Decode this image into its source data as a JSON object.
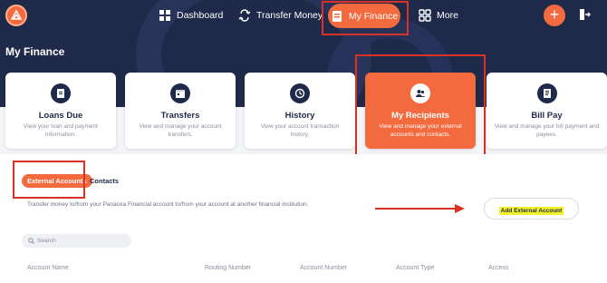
{
  "nav": {
    "dashboard": "Dashboard",
    "transfer": "Transfer Money",
    "finance": "My Finance",
    "more": "More",
    "add_symbol": "+"
  },
  "page": {
    "title": "My Finance"
  },
  "cards": [
    {
      "title": "Loans Due",
      "desc": "View your loan and payment information.",
      "icon": "document-icon"
    },
    {
      "title": "Transfers",
      "desc": "View and manage your account transfers.",
      "icon": "calendar-icon"
    },
    {
      "title": "History",
      "desc": "View your account transaction history.",
      "icon": "history-icon"
    },
    {
      "title": "My Recipients",
      "desc": "View and manage your external accounts and contacts.",
      "icon": "users-icon"
    },
    {
      "title": "Bill Pay",
      "desc": "View and manage your bill payment and payees.",
      "icon": "bill-icon"
    }
  ],
  "tabs": {
    "external": "External Accounts",
    "contacts": "Contacts"
  },
  "panel": {
    "description": "Transfer money to/from your Panacea Financial account to/from your account at another financial institution.",
    "add_button": "Add External Account",
    "search_placeholder": "Search"
  },
  "table": {
    "headers": [
      "Account Name",
      "Routing Number",
      "Account Number",
      "Account Type",
      "Access"
    ]
  },
  "colors": {
    "navy": "#1f2a4a",
    "accent": "#f26a3d",
    "annotation": "#d93124",
    "highlight": "#f3f32c"
  }
}
